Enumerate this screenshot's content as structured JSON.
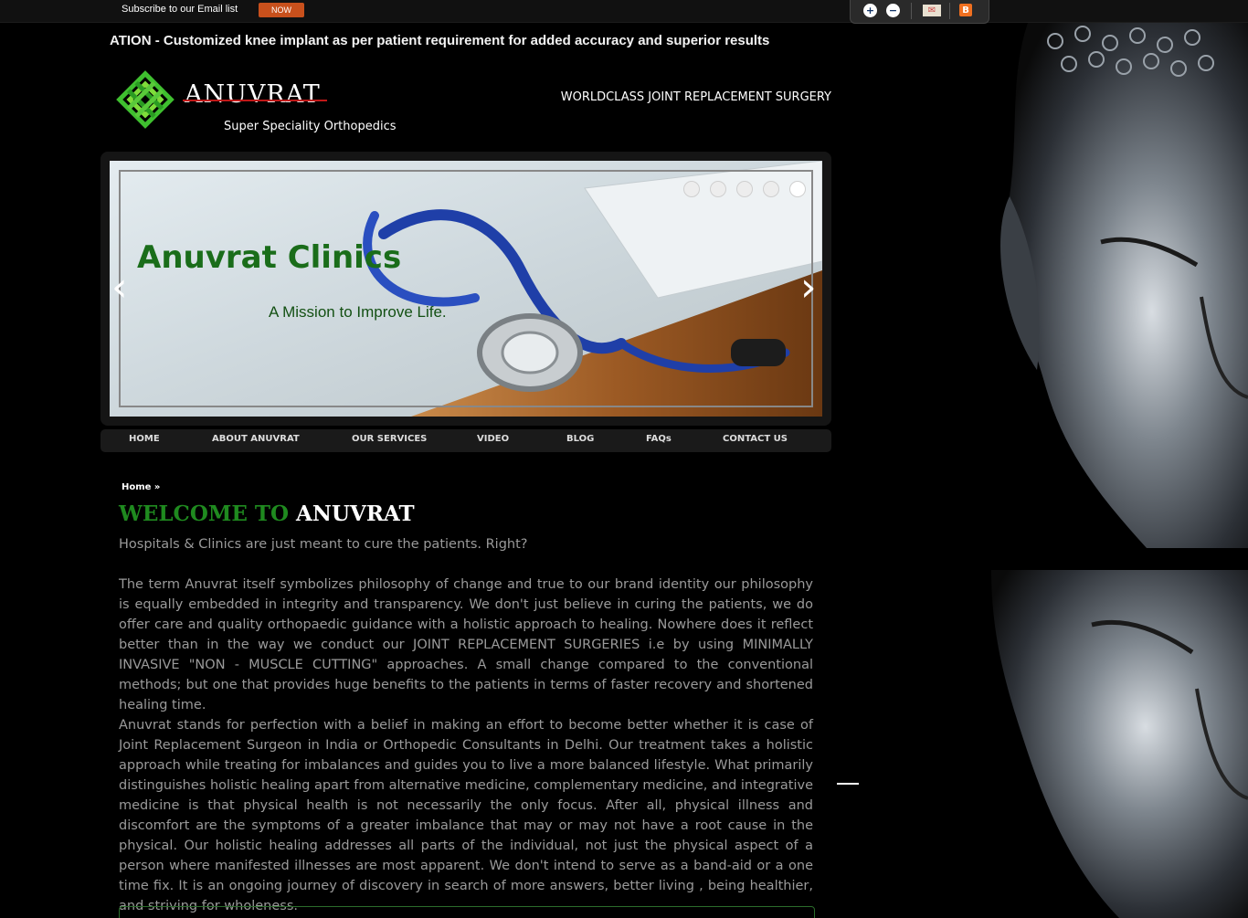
{
  "topbar": {
    "subscribe_text": "Subscribe to our Email list",
    "now_label": "NOW",
    "tools": [
      "zoom-in-icon",
      "zoom-out-icon",
      "mail-icon",
      "blogger-icon"
    ]
  },
  "marquee": {
    "text": "ATION - Customized knee implant as per patient requirement for added accuracy and superior results"
  },
  "header": {
    "logo_name": "ANUVRAT",
    "logo_tagline": "Super Speciality Orthopedics",
    "right_text": "WORLDCLASS JOINT REPLACEMENT SURGERY"
  },
  "slider": {
    "title": "Anuvrat Clinics",
    "subtitle": "A Mission to Improve Life.",
    "prev_arrow": "‹",
    "next_arrow": "›",
    "dot_count": 5,
    "active_dot": 5
  },
  "nav": {
    "items": [
      "HOME",
      "ABOUT ANUVRAT",
      "OUR SERVICES",
      "VIDEO",
      "BLOG",
      "FAQs",
      "CONTACT US"
    ]
  },
  "content": {
    "breadcrumb": "Home »",
    "welcome_green": "WELCOME TO",
    "welcome_white": "ANUVRAT",
    "intro": "Hospitals & Clinics are just meant to cure the patients. Right?",
    "para1": "The term Anuvrat itself symbolizes philosophy of change and true to our brand identity our philosophy is equally embedded in integrity and transparency. We don't just believe in curing the patients, we do offer care and quality orthopaedic guidance with a holistic approach to healing. Nowhere does it reflect better than in the way we conduct our JOINT REPLACEMENT SURGERIES i.e by using MINIMALLY INVASIVE \"NON - MUSCLE CUTTING\" approaches. A small change compared to the conventional methods; but one that provides huge benefits to the patients in terms of faster recovery and shortened healing time.",
    "para2": "Anuvrat stands for perfection with a belief in making an effort to become better whether it is case of Joint Replacement Surgeon in India or Orthopedic Consultants in Delhi. Our treatment takes a holistic approach while treating for imbalances and guides you to live a more balanced lifestyle. What primarily distinguishes holistic healing apart from alternative medicine, complementary medicine, and integrative medicine is that physical health is not necessarily the only focus. After all, physical illness and discomfort are the symptoms of a greater imbalance that may or may not have a root cause in the physical. Our holistic healing addresses all parts of the individual, not just the physical aspect of a person where manifested illnesses are most apparent. We don't intend to serve as a band-aid or a one time fix. It is an ongoing journey of discovery in search of more answers, better living , being healthier, and striving for wholeness."
  },
  "colors": {
    "accent_green": "#1f8a1f",
    "now_orange": "#c8501c",
    "logo_red": "#c01818"
  }
}
